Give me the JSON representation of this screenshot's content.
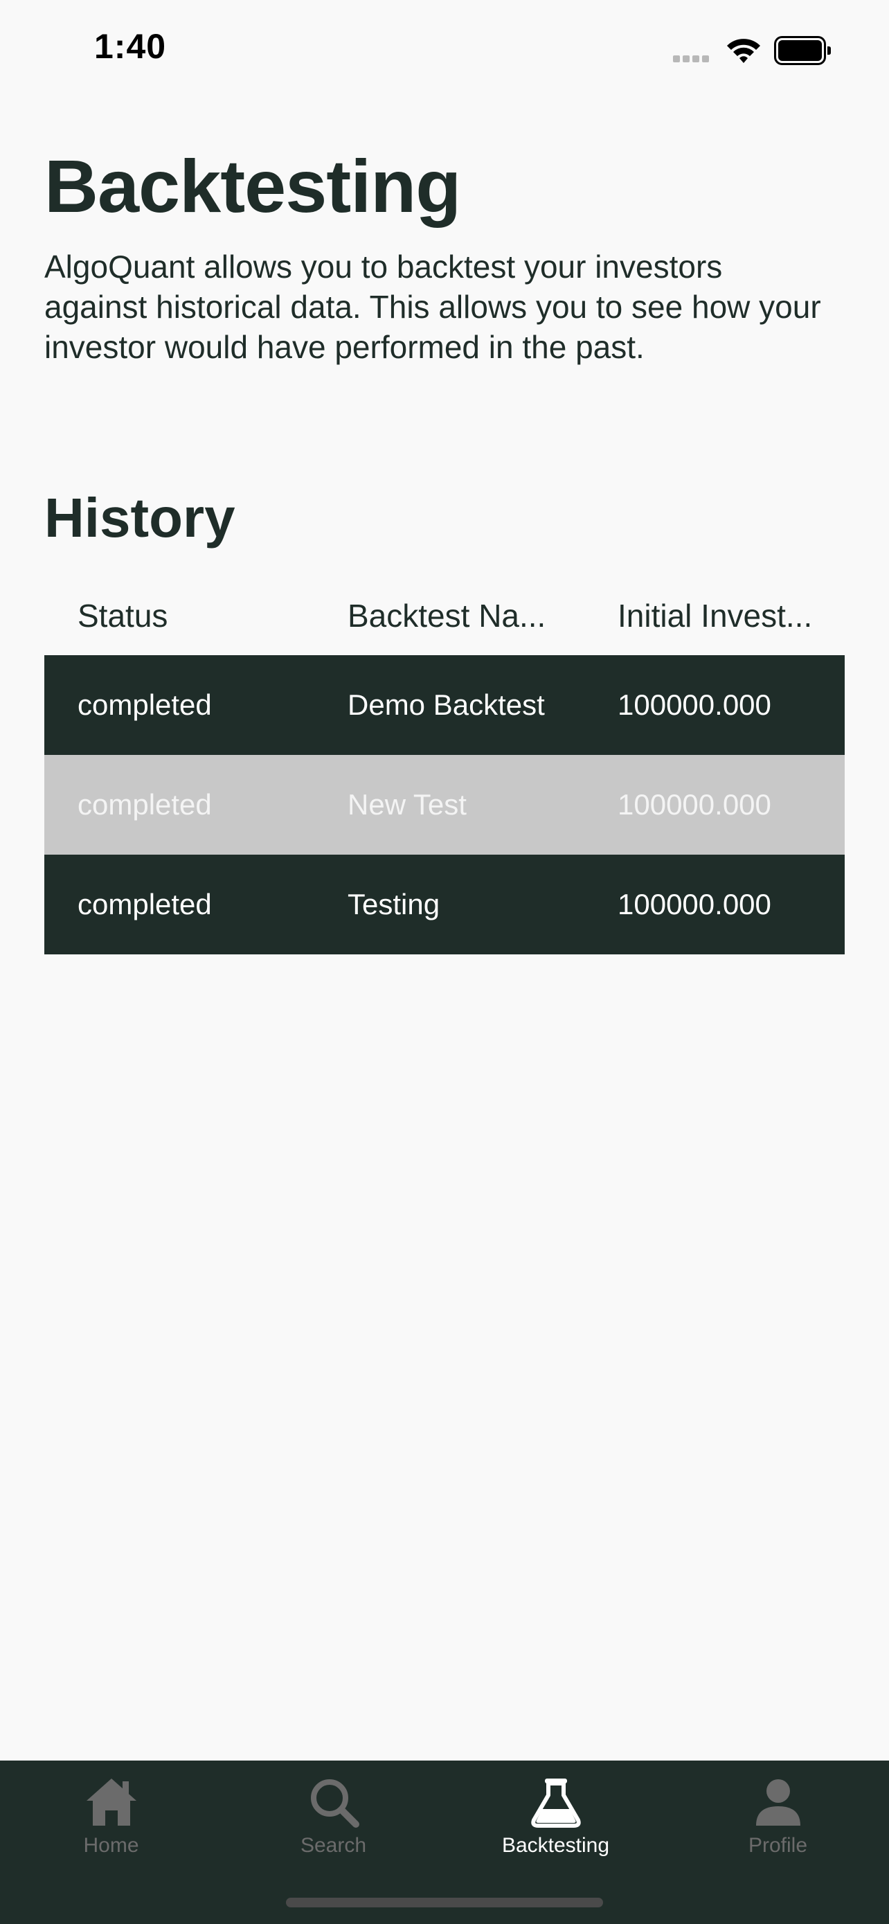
{
  "status_bar": {
    "time": "1:40"
  },
  "page": {
    "title": "Backtesting",
    "description": "AlgoQuant allows you to backtest your investors against historical data. This allows you to see how your investor would have performed in the past."
  },
  "history": {
    "title": "History",
    "columns": [
      "Status",
      "Backtest Na...",
      "Initial Invest..."
    ],
    "rows": [
      {
        "status": "completed",
        "name": "Demo Backtest",
        "initial": "100000.000"
      },
      {
        "status": "completed",
        "name": "New Test",
        "initial": "100000.000"
      },
      {
        "status": "completed",
        "name": "Testing",
        "initial": "100000.000"
      }
    ]
  },
  "tab_bar": {
    "tabs": [
      {
        "label": "Home",
        "icon": "home-icon",
        "active": false
      },
      {
        "label": "Search",
        "icon": "search-icon",
        "active": false
      },
      {
        "label": "Backtesting",
        "icon": "flask-icon",
        "active": true
      },
      {
        "label": "Profile",
        "icon": "profile-icon",
        "active": false
      }
    ]
  },
  "colors": {
    "primary": "#1f2d29",
    "background": "#f9f9f9",
    "row_highlight": "#c8c8c8",
    "inactive_tab": "#6b6b6b",
    "active_tab": "#ffffff"
  }
}
